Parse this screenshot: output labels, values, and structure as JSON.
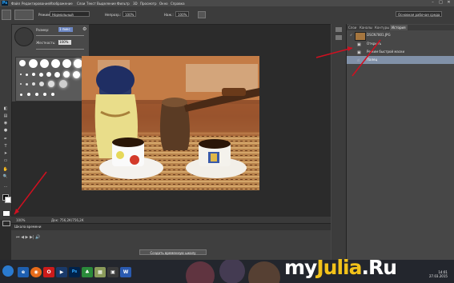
{
  "app": {
    "logo": "Ps"
  },
  "menu": [
    "Файл",
    "Редактирование",
    "Изображение",
    "Слои",
    "Текст",
    "Выделение",
    "Фильтр",
    "3D",
    "Просмотр",
    "Окно",
    "Справка"
  ],
  "window_controls": [
    "–",
    "□",
    "✕"
  ],
  "options": {
    "mode_label": "Режим:",
    "mode_value": "Нормальный",
    "opacity_label": "Непрозр.:",
    "opacity_value": "100%",
    "flow_label": "Наж.:",
    "flow_value": "100%",
    "workspace": "Основная рабочая среда"
  },
  "brush_panel": {
    "size_label": "Размер:",
    "size_value": "1 пикс",
    "hardness_label": "Жесткость:",
    "hardness_value": "100%"
  },
  "panels": {
    "tabs": [
      "Слои",
      "Каналы",
      "Контуры",
      "История"
    ],
    "active_tab": "История",
    "snapshot": "DSCN7801.JPG",
    "history": [
      "Открыть",
      "Режим быстрой маски",
      "Палец"
    ]
  },
  "status": {
    "zoom": "100%",
    "doc": "Док: 756,2К/756,2К"
  },
  "timeline": {
    "title": "Шкала времени",
    "create_button": "Создать временную шкалу"
  },
  "taskbar": {
    "time": "14:01",
    "date": "27.03.2015"
  },
  "watermark": {
    "part1": "my",
    "part2": "Julia",
    "part3": ".Ru"
  },
  "colors": {
    "accent": "#6b86c2",
    "history_selected": "#8191a8",
    "arrow": "#d01020"
  }
}
